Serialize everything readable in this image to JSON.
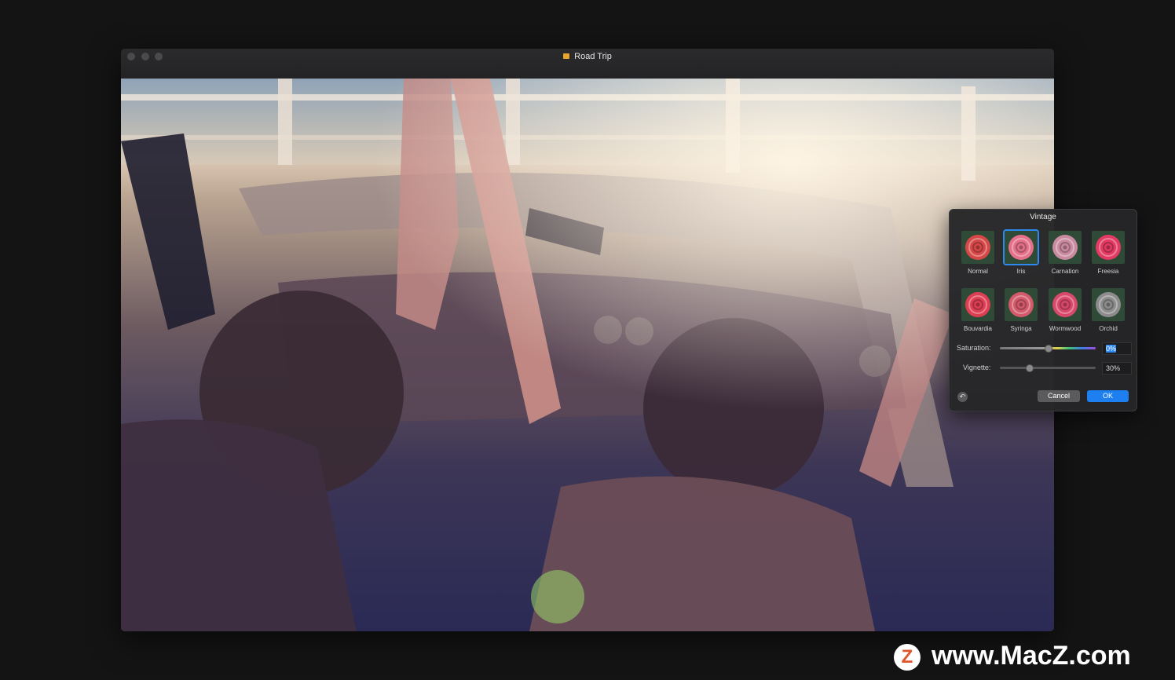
{
  "window": {
    "title": "Road Trip"
  },
  "panel": {
    "title": "Vintage",
    "presets": [
      {
        "label": "Normal",
        "selected": false,
        "tint": "#d64848"
      },
      {
        "label": "Iris",
        "selected": true,
        "tint": "#e4708a"
      },
      {
        "label": "Carnation",
        "selected": false,
        "tint": "#c98aa0"
      },
      {
        "label": "Freesia",
        "selected": false,
        "tint": "#e23a62"
      },
      {
        "label": "Bouvardia",
        "selected": false,
        "tint": "#de3e54"
      },
      {
        "label": "Syringa",
        "selected": false,
        "tint": "#d35a6a"
      },
      {
        "label": "Wormwood",
        "selected": false,
        "tint": "#d8486a"
      },
      {
        "label": "Orchid",
        "selected": false,
        "tint": "#8c8c8c"
      }
    ],
    "saturation": {
      "label": "Saturation:",
      "value": "0%",
      "level": 0.5
    },
    "vignette": {
      "label": "Vignette:",
      "value": "30%",
      "level": 0.3
    },
    "cancel_label": "Cancel",
    "ok_label": "OK",
    "reset_icon": "undo-icon"
  },
  "watermark": {
    "text": "www.MacZ.com",
    "logo_letter": "Z"
  },
  "colors": {
    "accent": "#1e7ff0",
    "panel_bg": "#262628"
  }
}
